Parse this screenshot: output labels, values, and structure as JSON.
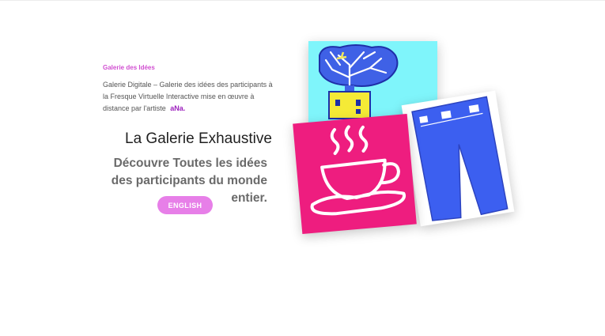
{
  "hero": {
    "eyebrow": "Galerie des Idées",
    "description": "Galerie Digitale – Galerie des idées des participants à la Fresque Virtuelle Interactive mise en œuvre à distance par l'artiste",
    "artist": "aNa.",
    "title": "La Galerie Exhaustive",
    "subtitle": "Découvre Toutes les idées des participants du monde entier.",
    "button_label": "ENGLISH"
  },
  "colors": {
    "accent_pink": "#e77fe8",
    "eyebrow": "#d14fd1",
    "artist_link": "#9c1fbd",
    "card_cyan": "#7ff5fb",
    "card_magenta": "#ee1d7f",
    "card_blue": "#3c5ff0"
  },
  "gallery": {
    "images": [
      {
        "subject": "tree-in-yellow-pot-drawing"
      },
      {
        "subject": "blue-jeans-drawing"
      },
      {
        "subject": "coffee-cup-drawing"
      }
    ]
  }
}
